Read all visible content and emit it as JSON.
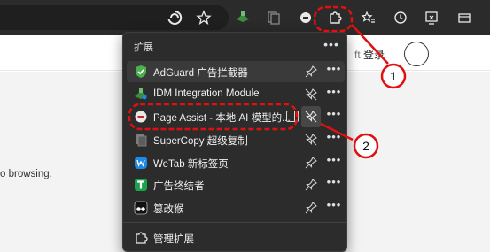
{
  "toolbar": {
    "icons": [
      "edge-sync-icon",
      "favorite-star-icon",
      "idm-extension-icon",
      "copy-extension-icon",
      "page-assist-icon",
      "extensions-puzzle-icon",
      "favorites-icon",
      "history-icon",
      "screenshot-icon",
      "settings-more-icon"
    ]
  },
  "page": {
    "login_text": "登录",
    "login_prefix": "ft",
    "bottom_fragment": "o browsing."
  },
  "extensions_panel": {
    "title": "扩展",
    "more_label": "•••",
    "items": [
      {
        "name": "AdGuard 广告拦截器",
        "icon": "adguard-icon",
        "icon_color": "#4caf50",
        "pinned": true
      },
      {
        "name": "IDM Integration Module",
        "icon": "idm-icon",
        "icon_color": "#2f7d32",
        "pinned": false
      },
      {
        "name": "Page Assist - 本地 AI 模型的...",
        "icon": "page-assist-icon",
        "icon_color": "#e0e0e0",
        "pinned": false
      },
      {
        "name": "SuperCopy 超级复制",
        "icon": "supercopy-icon",
        "icon_color": "#6f6f6f",
        "pinned": false
      },
      {
        "name": "WeTab 新标签页",
        "icon": "wetab-icon",
        "icon_color": "#1e88e5",
        "pinned": true
      },
      {
        "name": "广告终结者",
        "icon": "ad-terminator-icon",
        "icon_color": "#1aa34a",
        "pinned": true
      },
      {
        "name": "篡改猴",
        "icon": "tampermonkey-icon",
        "icon_color": "#111111",
        "pinned": true
      }
    ],
    "manage_label": "管理扩展"
  },
  "annotations": {
    "labels": [
      "1",
      "2"
    ],
    "color": "#e01010"
  }
}
